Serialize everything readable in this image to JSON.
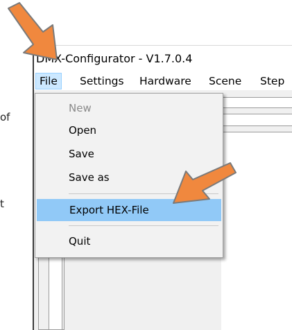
{
  "background_fragments": {
    "line1": "of",
    "line2": "t"
  },
  "window": {
    "title": "DMX-Configurator - V1.7.0.4"
  },
  "menubar": {
    "items": [
      "File",
      "Settings",
      "Hardware",
      "Scene",
      "Step"
    ]
  },
  "file_menu": {
    "items": [
      "New",
      "Open",
      "Save",
      "Save as",
      "Export HEX-File",
      "Quit"
    ],
    "disabled": [
      "New"
    ],
    "highlighted": "Export HEX-File"
  },
  "colors": {
    "highlight": "#91c9f7",
    "active_menu": "#cce8ff",
    "arrow": "#f0883e"
  },
  "icons": {
    "annotation": "arrow-pointer-icon"
  }
}
